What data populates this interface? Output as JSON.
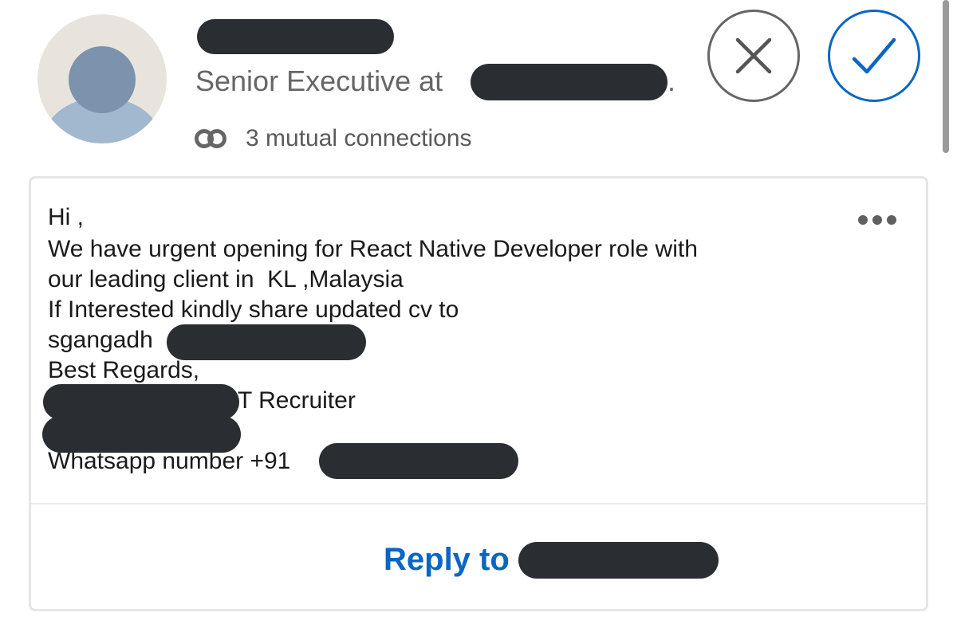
{
  "invitation": {
    "headline": "Senior Executive at",
    "headline_tail": ".",
    "mutual_connections": "3 mutual connections",
    "icons": {
      "avatar": "default-avatar",
      "mutual": "mutual-connections-icon",
      "ignore": "close-icon",
      "accept": "checkmark-icon",
      "more": "more-options-icon"
    },
    "colors": {
      "accent": "#0a66c2",
      "secondary_text": "#666666",
      "redaction": "#2a2e33"
    }
  },
  "message": {
    "lines": [
      "Hi ,",
      "We have urgent opening for React Native Developer role with",
      "our leading client in  KL ,Malaysia",
      "If Interested kindly share updated cv to",
      "sgangadh",
      "Best Regards,",
      "T Recruiter",
      "Whatsapp number +91"
    ]
  },
  "reply": {
    "label": "Reply to"
  }
}
